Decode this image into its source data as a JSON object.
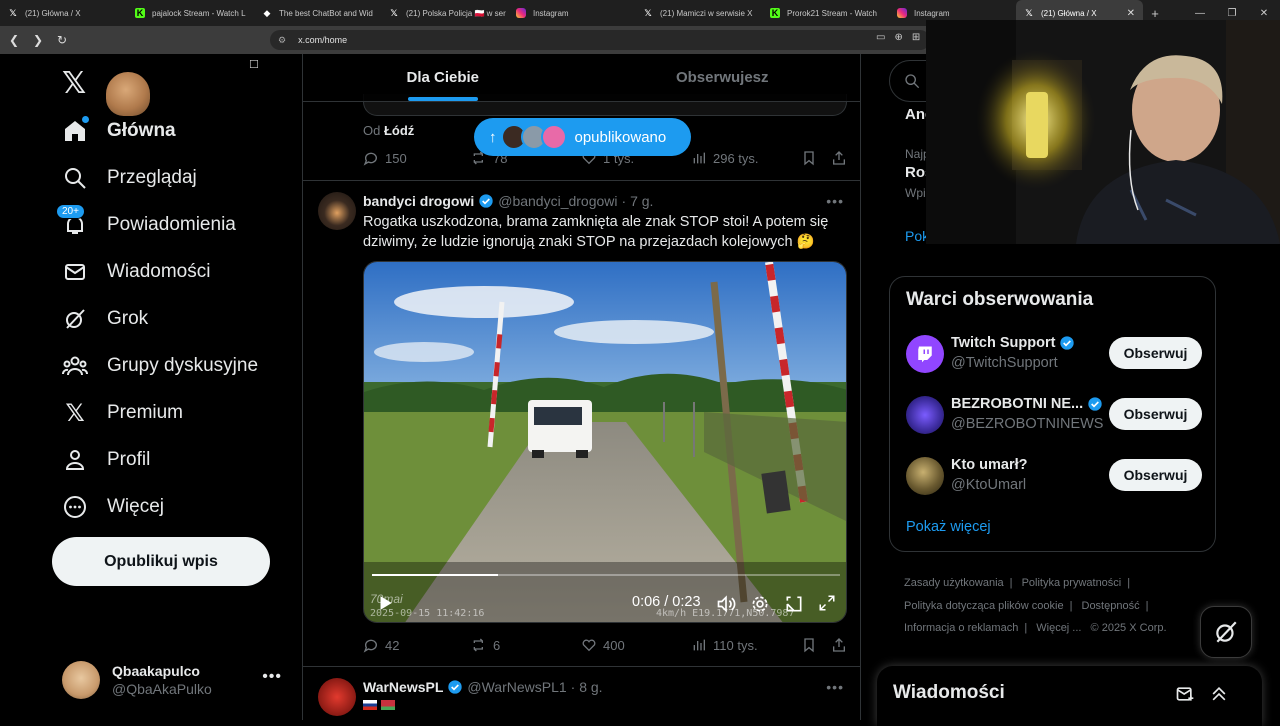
{
  "browser": {
    "tabs": [
      {
        "label": "(21) Główna / X",
        "icon": "x-icon"
      },
      {
        "label": "pajalock Stream - Watch L",
        "icon": "kick-icon"
      },
      {
        "label": "The best ChatBot and Wid",
        "icon": "chatbot-icon"
      },
      {
        "label": "(21) Polska Policja 🇵🇱 w ser",
        "icon": "x-icon"
      },
      {
        "label": "Instagram",
        "icon": "instagram-icon"
      },
      {
        "label": "(21) Mamiczi w serwisie X",
        "icon": "x-icon"
      },
      {
        "label": "Prorok21 Stream - Watch",
        "icon": "kick-icon"
      },
      {
        "label": "Instagram",
        "icon": "instagram-icon"
      },
      {
        "label": "(21) Główna / X",
        "icon": "x-icon",
        "active": true
      }
    ],
    "url": "x.com/home"
  },
  "nav": {
    "items": [
      {
        "label": "Główna",
        "icon": "home-icon"
      },
      {
        "label": "Przeglądaj",
        "icon": "search-icon"
      },
      {
        "label": "Powiadomienia",
        "icon": "bell-icon",
        "badge": "20+"
      },
      {
        "label": "Wiadomości",
        "icon": "mail-icon"
      },
      {
        "label": "Grok",
        "icon": "grok-icon"
      },
      {
        "label": "Grupy dyskusyjne",
        "icon": "communities-icon"
      },
      {
        "label": "Premium",
        "icon": "x-icon"
      },
      {
        "label": "Profil",
        "icon": "profile-icon"
      },
      {
        "label": "Więcej",
        "icon": "more-circle-icon"
      }
    ],
    "post_button": "Opublikuj wpis",
    "account": {
      "name": "Qbaakapulco",
      "handle": "@QbaAkaPulko"
    }
  },
  "feed": {
    "tabs": [
      "Dla Ciebie",
      "Obserwujesz"
    ],
    "toast": "opublikowano",
    "prev_post": {
      "from_prefix": "Od",
      "from_place": "Łódź",
      "replies": "150",
      "reposts": "78",
      "likes": "1 tys.",
      "views": "296 tys."
    },
    "post": {
      "name": "bandyci drogowi",
      "handle": "@bandyci_drogowi",
      "time": "· 7 g.",
      "text": "Rogatka uszkodzona, brama zamknięta ale znak STOP stoi! A potem się dziwimy, że ludzie ignorują znaki STOP na przejazdach kolejowych 🤔",
      "video": {
        "time": "0:06 / 0:23",
        "progress": 0.27,
        "stamp_date": "2025-09-15 11:42:16",
        "stamp_gps": "4km/h E19.1771,N50.7987",
        "brand": "70mai"
      },
      "replies": "42",
      "reposts": "6",
      "likes": "400",
      "views": "110 tys."
    },
    "next_post": {
      "name": "WarNewsPL",
      "handle": "@WarNewsPL1",
      "time": "· 8 g."
    }
  },
  "right": {
    "search_placeholder": "S",
    "trend_frag_1": "Ang",
    "trend_frag_2": "Najp",
    "trend_frag_3": "Ros",
    "trend_frag_4": "Wpi",
    "trend_frag_5": "Pok",
    "who_to_follow": {
      "title": "Warci obserwowania",
      "accounts": [
        {
          "name": "Twitch Support",
          "handle": "@TwitchSupport",
          "button": "Obserwuj"
        },
        {
          "name": "BEZROBOTNI NE...",
          "handle": "@BEZROBOTNINEWS",
          "button": "Obserwuj"
        },
        {
          "name": "Kto umarł?",
          "handle": "@KtoUmarl",
          "button": "Obserwuj"
        }
      ],
      "show_more": "Pokaż więcej"
    },
    "footer": {
      "links": [
        "Zasady użytkowania",
        "|",
        "Polityka prywatności",
        "|",
        "Polityka dotycząca plików cookie",
        "|",
        "Dostępność",
        "|",
        "Informacja o reklamach",
        "|",
        "Więcej ...",
        "© 2025 X Corp."
      ]
    },
    "messages_title": "Wiadomości"
  },
  "colors": {
    "accent": "#1d9bf0",
    "bg": "#000000",
    "text": "#e7e9ea",
    "muted": "#71767b",
    "border": "#2f3336"
  }
}
